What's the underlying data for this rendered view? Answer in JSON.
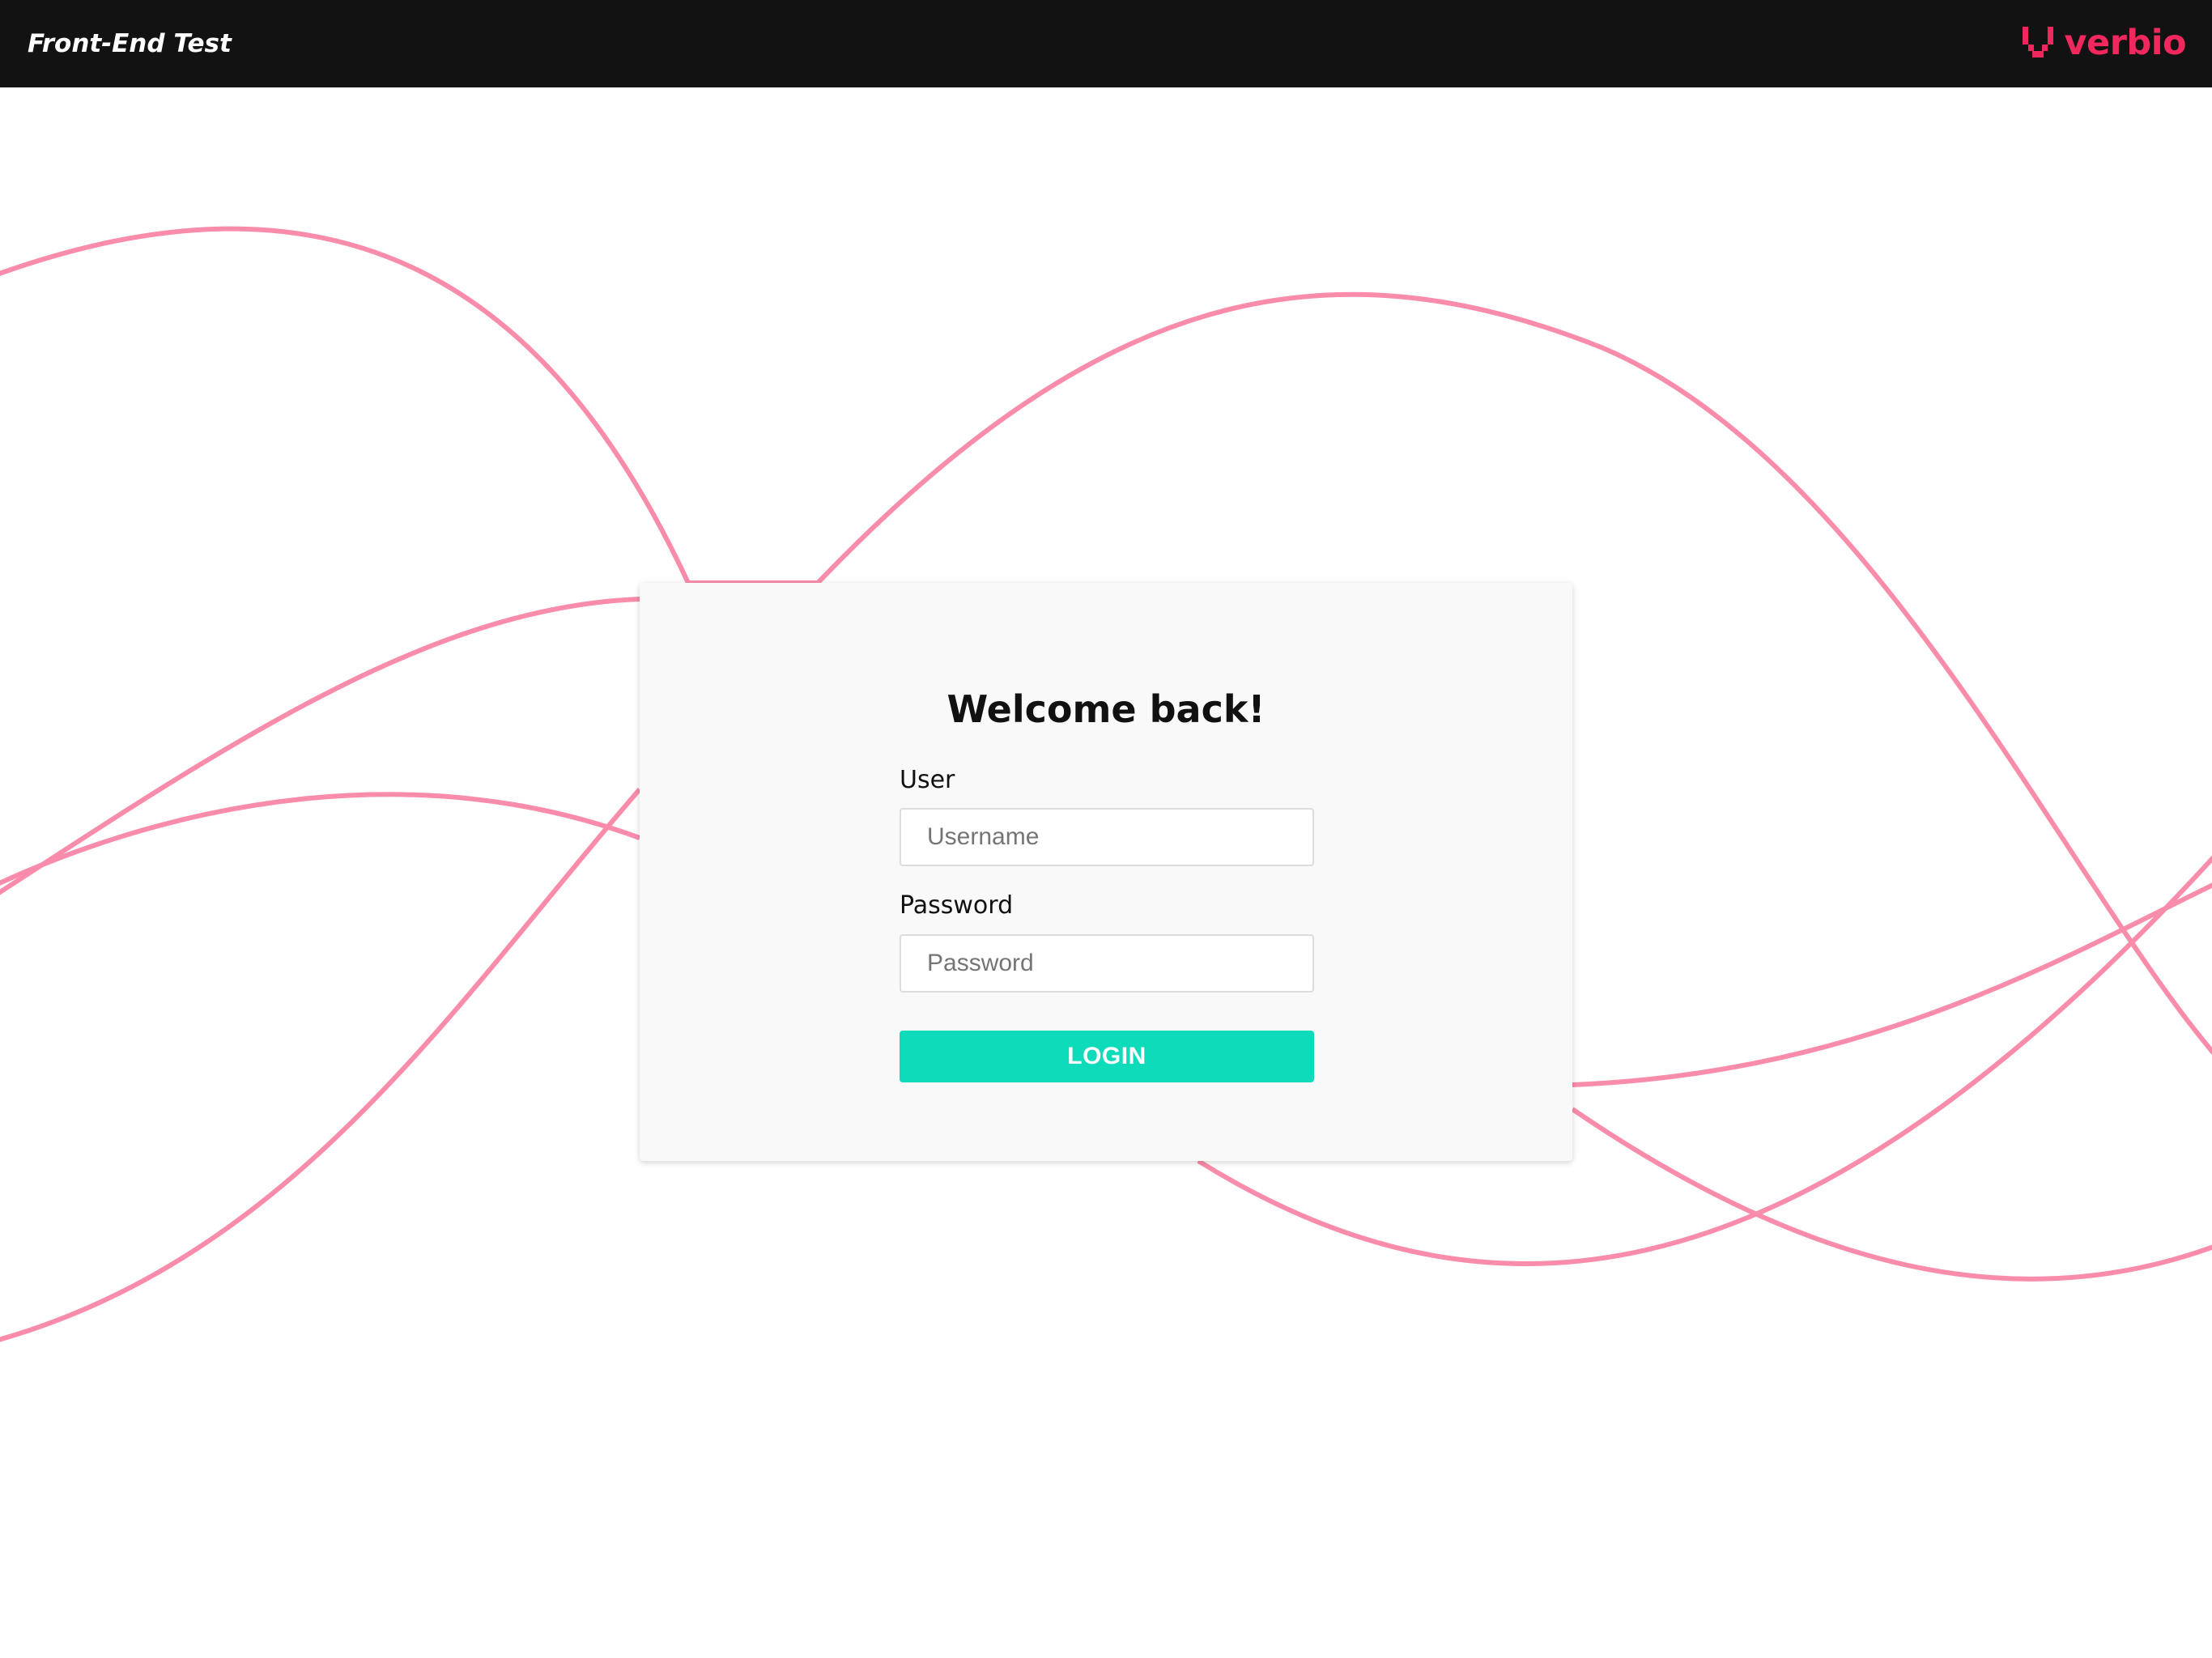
{
  "header": {
    "app_title": "Front-End Test",
    "brand_name": "verbio",
    "brand_icon": "verbio-logo-icon"
  },
  "login": {
    "title": "Welcome back!",
    "user_label": "User",
    "user_placeholder": "Username",
    "user_value": "",
    "password_label": "Password",
    "password_placeholder": "Password",
    "password_value": "",
    "button_label": "LOGIN"
  },
  "colors": {
    "topbar": "#121212",
    "brand": "#f0285e",
    "wave_lines": "#f98caa",
    "card_background": "#f9f9f9",
    "login_button": "#0ddbb9"
  }
}
